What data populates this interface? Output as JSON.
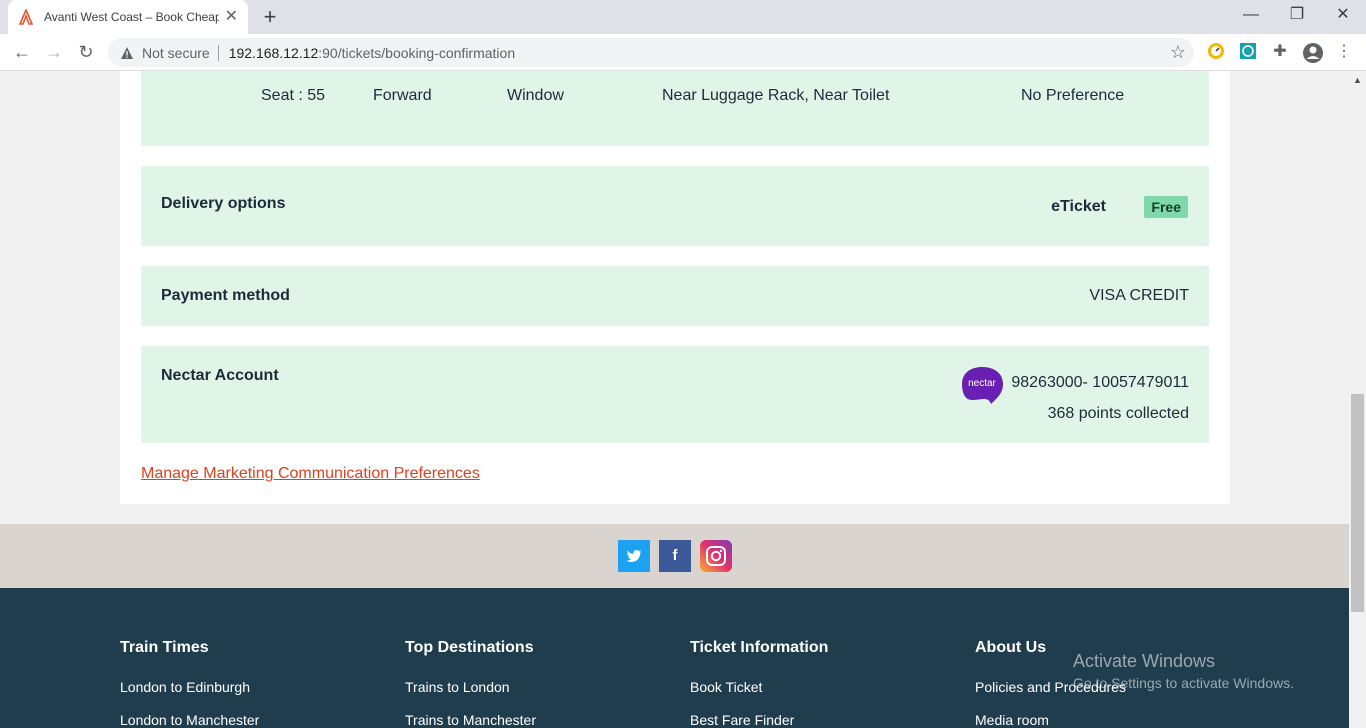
{
  "browser": {
    "tab_title": "Avanti West Coast – Book Cheap",
    "tab_close": "✕",
    "new_tab": "+",
    "not_secure": "Not secure",
    "url_host": "192.168.12.12",
    "url_path": ":90/tickets/booking-confirmation",
    "minimize": "—",
    "restore": "❐",
    "close": "✕"
  },
  "seat": {
    "seat_label": "Seat : 55",
    "direction": "Forward",
    "position": "Window",
    "features": "Near Luggage Rack, Near Toilet",
    "preference": "No Preference"
  },
  "delivery": {
    "label": "Delivery options",
    "value": "eTicket",
    "badge": "Free"
  },
  "payment": {
    "label": "Payment method",
    "value": "VISA CREDIT"
  },
  "nectar": {
    "label": "Nectar Account",
    "logo_text": "nectar",
    "account_number": "98263000- 10057479011",
    "points": "368 points collected"
  },
  "manage_link": "Manage Marketing Communication Preferences",
  "social": {
    "twitter": "t",
    "facebook": "f"
  },
  "footer": {
    "columns": [
      {
        "heading": "Train Times",
        "links": [
          "London to Edinburgh",
          "London to Manchester"
        ]
      },
      {
        "heading": "Top Destinations",
        "links": [
          "Trains to London",
          "Trains to Manchester"
        ]
      },
      {
        "heading": "Ticket Information",
        "links": [
          "Book Ticket",
          "Best Fare Finder"
        ]
      },
      {
        "heading": "About Us",
        "links": [
          "Policies and Procedures",
          "Media room"
        ]
      }
    ]
  },
  "watermark": {
    "title": "Activate Windows",
    "subtitle": "Go to Settings to activate Windows."
  },
  "colors": {
    "panel_bg": "#e1f4e8",
    "link": "#e0401f",
    "footer_bg": "#1f3d4d",
    "badge_bg": "#7fd8a9"
  }
}
